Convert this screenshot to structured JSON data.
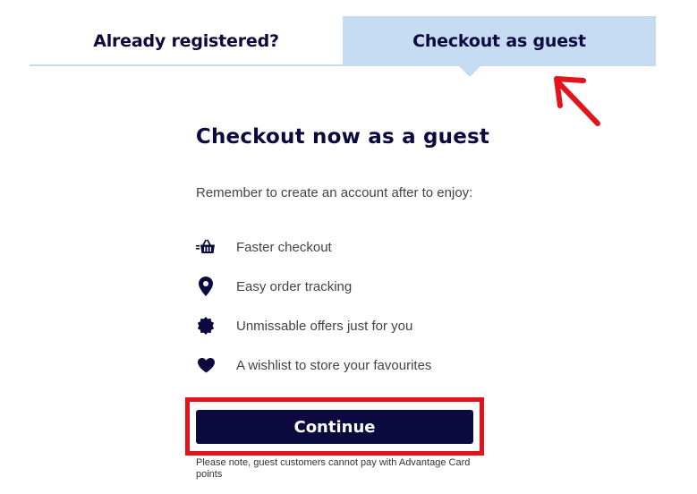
{
  "tabs": {
    "registered_label": "Already registered?",
    "guest_label": "Checkout as guest"
  },
  "main": {
    "heading": "Checkout now as a guest",
    "intro": "Remember to create an account after to enjoy:",
    "benefits": [
      {
        "icon": "basket-icon",
        "label": "Faster checkout"
      },
      {
        "icon": "location-pin-icon",
        "label": "Easy order tracking"
      },
      {
        "icon": "offer-badge-icon",
        "label": "Unmissable offers just for you"
      },
      {
        "icon": "heart-icon",
        "label": "A wishlist to store your favourites"
      }
    ],
    "continue_label": "Continue",
    "note": "Please note, guest customers cannot pay with Advantage Card points"
  },
  "colors": {
    "navy": "#0b0a3e",
    "tab_active_bg": "#c6dcf3",
    "annotation_red": "#e3131b"
  }
}
